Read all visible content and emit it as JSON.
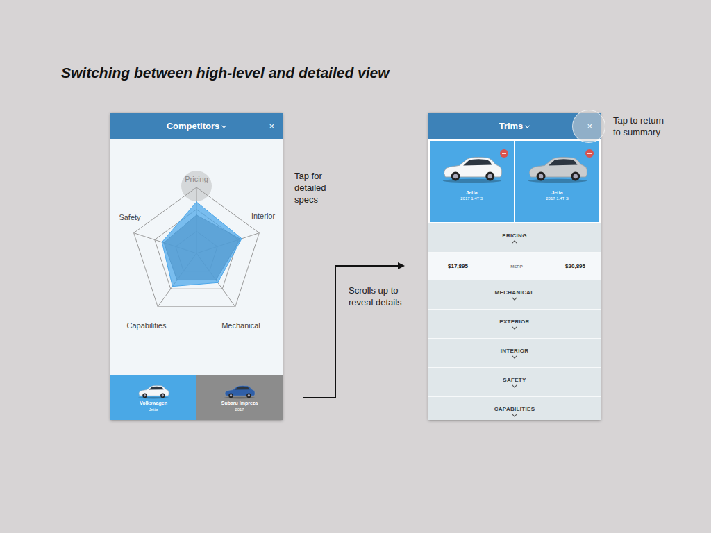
{
  "slide": {
    "title": "Switching between high-level and detailed view"
  },
  "summary": {
    "title": "Competitors",
    "close": "×",
    "chart": {
      "axes": [
        {
          "label": "Pricing",
          "highlighted": true
        },
        {
          "label": "Interior",
          "highlighted": false
        },
        {
          "label": "Mechanical",
          "highlighted": false
        },
        {
          "label": "Capabilities",
          "highlighted": false
        },
        {
          "label": "Safety",
          "highlighted": false
        }
      ],
      "series": [
        {
          "color": "#6d7a88",
          "values": [
            58,
            70,
            50,
            50,
            52
          ]
        },
        {
          "color": "#4aa6ea",
          "values": [
            78,
            72,
            55,
            62,
            55
          ]
        }
      ]
    },
    "vehicles": [
      {
        "title": "Volkswagen",
        "subtitle": "Jetta",
        "selected": true
      },
      {
        "title": "Subaru Impreza",
        "subtitle": "2017",
        "selected": false
      }
    ]
  },
  "detail": {
    "title": "Trims",
    "close": "×",
    "trims": [
      {
        "name": "Jetta",
        "trim": "2017 1.4T S"
      },
      {
        "name": "Jetta",
        "trim": "2017 1.4T S"
      }
    ],
    "sections": [
      {
        "label": "PRICING",
        "expanded": true,
        "rows": [
          {
            "left": "$17,895",
            "label": "MSRP",
            "right": "$20,895"
          }
        ]
      },
      {
        "label": "MECHANICAL",
        "expanded": false,
        "rows": []
      },
      {
        "label": "EXTERIOR",
        "expanded": false,
        "rows": []
      },
      {
        "label": "INTERIOR",
        "expanded": false,
        "rows": []
      },
      {
        "label": "SAFETY",
        "expanded": false,
        "rows": []
      },
      {
        "label": "CAPABILITIES",
        "expanded": false,
        "rows": []
      }
    ]
  },
  "annotations": {
    "tap_pricing": {
      "lines": [
        "Tap for",
        "detailed",
        "specs"
      ]
    },
    "scroll": {
      "lines": [
        "Scrolls up to",
        "reveal details"
      ]
    },
    "tap_close": {
      "lines": [
        "Tap to return",
        "to summary"
      ]
    }
  }
}
